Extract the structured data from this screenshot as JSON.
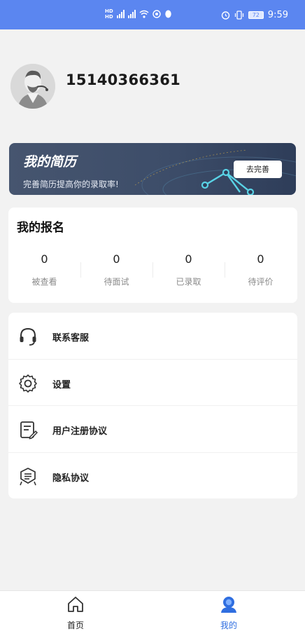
{
  "status_bar": {
    "hd_top": "HD",
    "hd_bottom": "HD",
    "battery": "72",
    "time": "9:59"
  },
  "profile": {
    "phone": "15140366361"
  },
  "resume": {
    "title": "我的简历",
    "subtitle": "完善简历提高你的录取率!",
    "button": "去完善"
  },
  "applications": {
    "title": "我的报名",
    "stats": [
      {
        "value": "0",
        "label": "被查看"
      },
      {
        "value": "0",
        "label": "待面试"
      },
      {
        "value": "0",
        "label": "已录取"
      },
      {
        "value": "0",
        "label": "待评价"
      }
    ]
  },
  "menu": {
    "items": [
      {
        "label": "联系客服",
        "icon": "headset-icon"
      },
      {
        "label": "设置",
        "icon": "gear-icon"
      },
      {
        "label": "用户注册协议",
        "icon": "document-icon"
      },
      {
        "label": "隐私协议",
        "icon": "privacy-icon"
      }
    ]
  },
  "tabbar": {
    "tabs": [
      {
        "label": "首页",
        "icon": "home-icon"
      },
      {
        "label": "我的",
        "icon": "user-icon"
      }
    ],
    "active_color": "#2f6ee0"
  },
  "colors": {
    "status_bar": "#5b86f0",
    "resume_card": "#3d4d69",
    "background": "#f2f2f2"
  }
}
